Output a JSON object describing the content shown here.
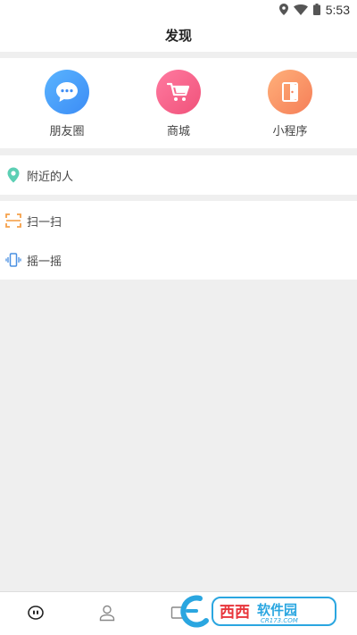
{
  "status_bar": {
    "time": "5:53",
    "icons": [
      "location-icon",
      "wifi-icon",
      "battery-icon"
    ]
  },
  "header": {
    "title": "发现"
  },
  "quick_actions": [
    {
      "label": "朋友圈",
      "icon": "chat-bubble-icon",
      "color_from": "#5ab4ff",
      "color_to": "#3c8cf5"
    },
    {
      "label": "商城",
      "icon": "shopping-cart-icon",
      "color_from": "#ff7aa0",
      "color_to": "#f0527a"
    },
    {
      "label": "小程序",
      "icon": "door-icon",
      "color_from": "#ffb07a",
      "color_to": "#f57e58"
    }
  ],
  "nearby": {
    "label": "附近的人",
    "icon": "location-pin-icon",
    "icon_color": "#5ccfb4"
  },
  "scan": {
    "label": "扫一扫",
    "icon": "scan-icon",
    "icon_color": "#f5a04a"
  },
  "shake": {
    "label": "摇一摇",
    "icon": "shake-phone-icon",
    "icon_color": "#4a90e2"
  },
  "tabbar": {
    "tabs": [
      {
        "icon": "chat-tab-icon"
      },
      {
        "icon": "contacts-tab-icon"
      },
      {
        "icon": "discover-tab-icon"
      }
    ]
  },
  "watermark": {
    "brand": "西西软件园",
    "url": "CR173.COM"
  }
}
